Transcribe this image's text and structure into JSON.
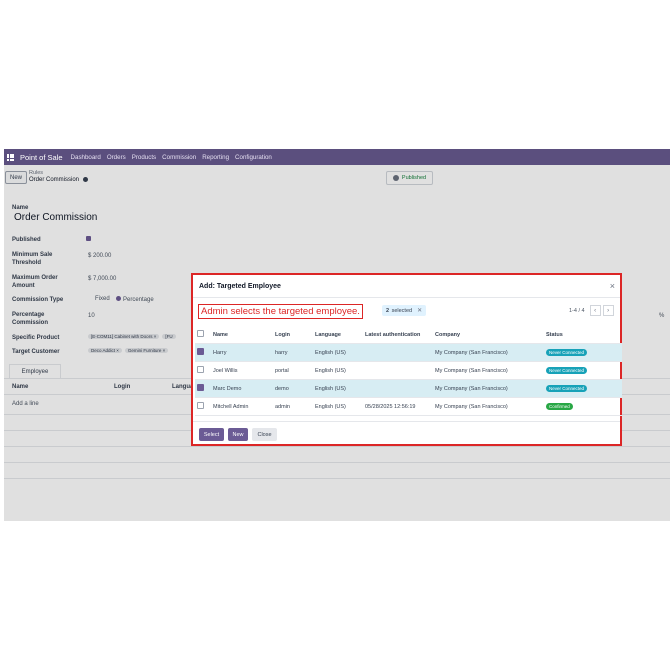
{
  "nav": {
    "brand": "Point of Sale",
    "menu": [
      "Dashboard",
      "Orders",
      "Products",
      "Commission",
      "Reporting",
      "Configuration"
    ]
  },
  "control_panel": {
    "new_label": "New",
    "breadcrumb_parent": "Rules",
    "breadcrumb_current": "Order Commission",
    "published_label": "Published"
  },
  "form": {
    "name_label": "Name",
    "name_value": "Order Commission",
    "published_label": "Published",
    "min_label": "Minimum Sale Threshold",
    "min_value": "$ 200.00",
    "max_label": "Maximum Order Amount",
    "max_value": "$ 7,000.00",
    "type_label": "Commission Type",
    "type_fixed": "Fixed",
    "type_percentage": "Percentage",
    "pct_label": "Percentage Commission",
    "pct_value": "10",
    "pct_unit": "%",
    "product_label": "Specific Product",
    "product_tags": [
      "[E-COM11] Cabinet with Doors",
      "[FU"
    ],
    "customer_label": "Target Customer",
    "customer_tags": [
      "Deco Addict",
      "Gemini Furniture"
    ],
    "tab_employee": "Employee",
    "col_name": "Name",
    "col_login": "Login",
    "col_lang": "Langua",
    "add_line": "Add a line"
  },
  "modal": {
    "title": "Add: Targeted Employee",
    "annotation": "Admin selects the targeted employee.",
    "selected_count": "2",
    "selected_text": "selected",
    "pager": "1-4 / 4",
    "columns": [
      "Name",
      "Login",
      "Language",
      "Latest authentication",
      "Company",
      "Status"
    ],
    "rows": [
      {
        "name": "Harry",
        "login": "harry",
        "lang": "English (US)",
        "auth": "",
        "company": "My Company (San Francisco)",
        "status": "Never Connected",
        "selected": true
      },
      {
        "name": "Joel Willis",
        "login": "portal",
        "lang": "English (US)",
        "auth": "",
        "company": "My Company (San Francisco)",
        "status": "Never Connected",
        "selected": false
      },
      {
        "name": "Marc Demo",
        "login": "demo",
        "lang": "English (US)",
        "auth": "",
        "company": "My Company (San Francisco)",
        "status": "Never Connected",
        "selected": true
      },
      {
        "name": "Mitchell Admin",
        "login": "admin",
        "lang": "English (US)",
        "auth": "05/28/2025 12:56:19",
        "company": "My Company (San Francisco)",
        "status": "Confirmed",
        "selected": false
      }
    ],
    "select_label": "Select",
    "new_label": "New",
    "close_label": "Close"
  }
}
